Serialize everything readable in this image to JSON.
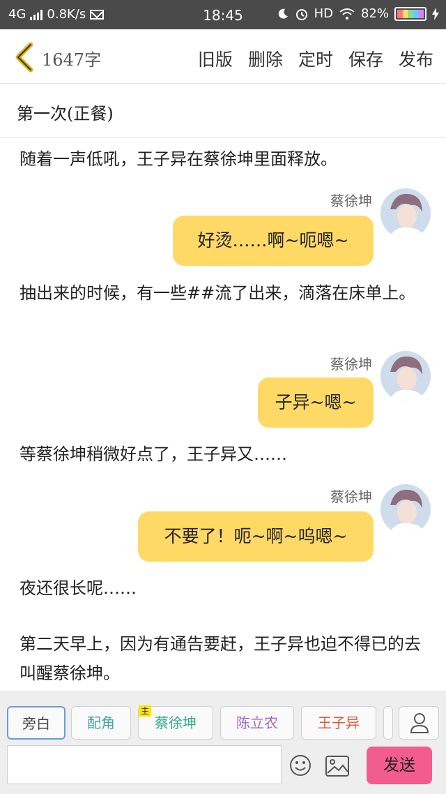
{
  "status_bar": {
    "network": "4G",
    "speed": "0.8K/s",
    "time": "18:45",
    "hd": "HD",
    "battery": "82%"
  },
  "toolbar": {
    "word_count": "1647字",
    "actions": [
      "旧版",
      "删除",
      "定时",
      "保存",
      "发布"
    ]
  },
  "chapter": {
    "title": "第一次(正餐)"
  },
  "content": {
    "narrations": [
      "随着一声低吼，王子异在蔡徐坤里面释放。",
      "抽出来的时候，有一些##流了出来，滴落在床单上。",
      "等蔡徐坤稍微好点了，王子异又……",
      "夜还很长呢……",
      "第二天早上，因为有通告要赶，王子异也迫不得已的去叫醒蔡徐坤。"
    ],
    "messages": [
      {
        "name": "蔡徐坤",
        "text": "好烫……啊~呃嗯~"
      },
      {
        "name": "蔡徐坤",
        "text": "子异~嗯~"
      },
      {
        "name": "蔡徐坤",
        "text": "不要了！呃~啊~呜嗯~"
      }
    ]
  },
  "bottom": {
    "roles": [
      "旁白",
      "配角",
      "蔡徐坤",
      "陈立农",
      "王子异"
    ],
    "lead_badge": "主",
    "send_label": "发送"
  },
  "colors": {
    "bubble": "#ffd966",
    "send_button": "#f25c8f",
    "role_peijiao": "#4aa3a3",
    "role_kun": "#2eaa8a",
    "role_chenlinong": "#9a66cc",
    "role_wangziyi": "#e05a3a"
  }
}
